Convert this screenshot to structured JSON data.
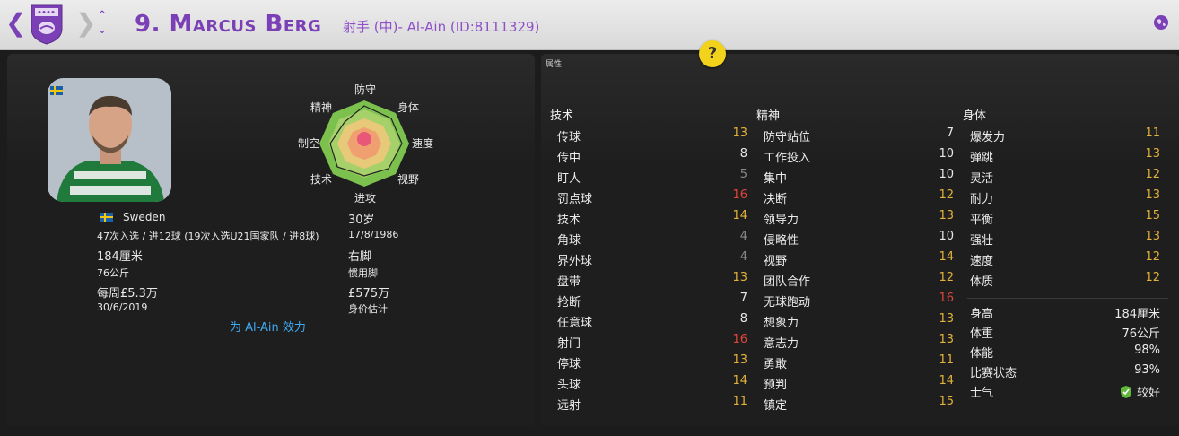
{
  "header": {
    "player_name": "9. Marcus Berg",
    "position_club": "射手 (中)- Al-Ain (ID:8111329)"
  },
  "help_label": "?",
  "colors": {
    "accent": "#7b3fb6",
    "link": "#3ea9ef",
    "good": "#e8e8e8",
    "value_gold": "#e2b13a",
    "value_red": "#e0463a",
    "value_grey": "#8a8a8a"
  },
  "profile": {
    "nation": "Sweden",
    "caps": "47次入选 / 进12球 (19次入选U21国家队 / 进8球)",
    "height": "184厘米",
    "weight": "76公斤",
    "wage": "每周£5.3万",
    "contract_end": "30/6/2019",
    "age": "30岁",
    "dob": "17/8/1986",
    "foot": "右脚",
    "foot_label": "惯用脚",
    "value": "£575万",
    "value_label": "身价估计",
    "plays_for": "为 Al-Ain 效力"
  },
  "radar": {
    "labels": [
      "防守",
      "身体",
      "速度",
      "视野",
      "进攻",
      "技术",
      "制空",
      "精神"
    ]
  },
  "attributes": {
    "title": "属性",
    "technical_head": "技术",
    "mental_head": "精神",
    "physical_head": "身体",
    "technical": [
      {
        "name": "传球",
        "value": "13",
        "tone": "gold"
      },
      {
        "name": "传中",
        "value": "8",
        "tone": "white"
      },
      {
        "name": "盯人",
        "value": "5",
        "tone": "grey"
      },
      {
        "name": "罚点球",
        "value": "16",
        "tone": "red"
      },
      {
        "name": "技术",
        "value": "14",
        "tone": "gold"
      },
      {
        "name": "角球",
        "value": "4",
        "tone": "grey"
      },
      {
        "name": "界外球",
        "value": "4",
        "tone": "grey"
      },
      {
        "name": "盘带",
        "value": "13",
        "tone": "gold"
      },
      {
        "name": "抢断",
        "value": "7",
        "tone": "white"
      },
      {
        "name": "任意球",
        "value": "8",
        "tone": "white"
      },
      {
        "name": "射门",
        "value": "16",
        "tone": "red"
      },
      {
        "name": "停球",
        "value": "13",
        "tone": "gold"
      },
      {
        "name": "头球",
        "value": "14",
        "tone": "gold"
      },
      {
        "name": "远射",
        "value": "11",
        "tone": "gold"
      }
    ],
    "mental": [
      {
        "name": "防守站位",
        "value": "7",
        "tone": "white"
      },
      {
        "name": "工作投入",
        "value": "10",
        "tone": "white"
      },
      {
        "name": "集中",
        "value": "10",
        "tone": "white"
      },
      {
        "name": "决断",
        "value": "12",
        "tone": "gold"
      },
      {
        "name": "领导力",
        "value": "13",
        "tone": "gold"
      },
      {
        "name": "侵略性",
        "value": "10",
        "tone": "white"
      },
      {
        "name": "视野",
        "value": "14",
        "tone": "gold"
      },
      {
        "name": "团队合作",
        "value": "12",
        "tone": "gold"
      },
      {
        "name": "无球跑动",
        "value": "16",
        "tone": "red"
      },
      {
        "name": "想象力",
        "value": "13",
        "tone": "gold"
      },
      {
        "name": "意志力",
        "value": "13",
        "tone": "gold"
      },
      {
        "name": "勇敢",
        "value": "11",
        "tone": "gold"
      },
      {
        "name": "预判",
        "value": "14",
        "tone": "gold"
      },
      {
        "name": "镇定",
        "value": "15",
        "tone": "gold"
      }
    ],
    "physical": [
      {
        "name": "爆发力",
        "value": "11",
        "tone": "gold"
      },
      {
        "name": "弹跳",
        "value": "13",
        "tone": "gold"
      },
      {
        "name": "灵活",
        "value": "12",
        "tone": "gold"
      },
      {
        "name": "耐力",
        "value": "13",
        "tone": "gold"
      },
      {
        "name": "平衡",
        "value": "15",
        "tone": "gold"
      },
      {
        "name": "强壮",
        "value": "13",
        "tone": "gold"
      },
      {
        "name": "速度",
        "value": "12",
        "tone": "gold"
      },
      {
        "name": "体质",
        "value": "12",
        "tone": "gold"
      }
    ],
    "physical_info": [
      {
        "name": "身高",
        "value": "184厘米"
      },
      {
        "name": "体重",
        "value": "76公斤"
      },
      {
        "name": "体能",
        "value": "98%"
      },
      {
        "name": "比赛状态",
        "value": "93%"
      },
      {
        "name": "士气",
        "value": "较好"
      }
    ]
  }
}
